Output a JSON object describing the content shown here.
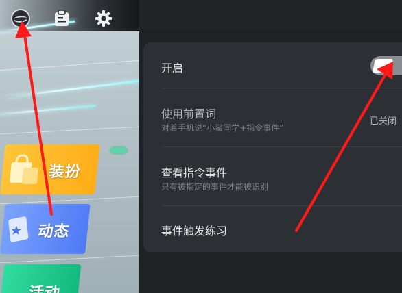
{
  "left": {
    "menu": [
      {
        "label": "装扮",
        "color": "#ffad16"
      },
      {
        "label": "动态",
        "color": "#4f79f4"
      },
      {
        "label": "活动",
        "color": "#12b77e"
      }
    ],
    "top_icons": [
      "app-logo-icon",
      "clipboard-icon",
      "gear-icon"
    ]
  },
  "settings": {
    "enable": {
      "label": "开启",
      "toggle_on": true
    },
    "prefix": {
      "label": "使用前置词",
      "description": "对着手机说“小鲨同学+指令事件”",
      "status": "已关闭"
    },
    "view_events": {
      "label": "查看指令事件",
      "description": "只有被指定的事件才能被识别"
    },
    "practice": {
      "label": "事件触发练习"
    }
  },
  "annotation_color": "#ff1a1a"
}
